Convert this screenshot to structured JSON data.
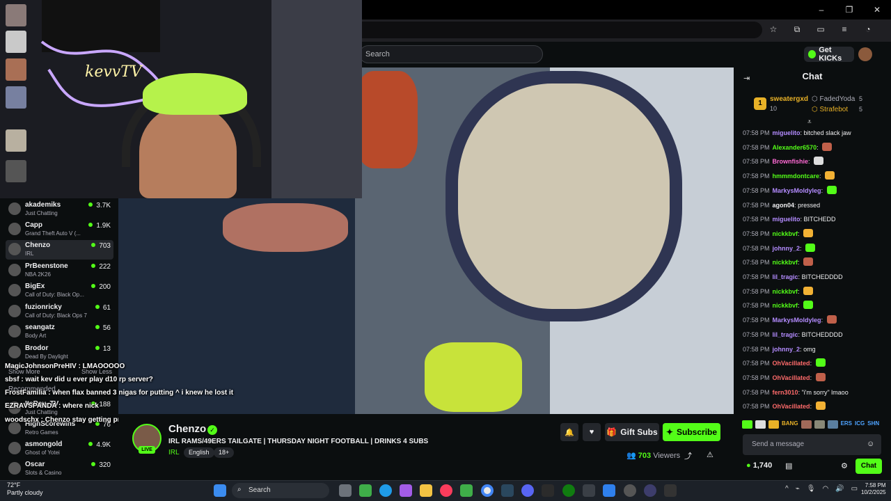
{
  "browser": {
    "window_controls": [
      "–",
      "❐",
      "✕"
    ],
    "toolbar_icons": [
      "star-icon",
      "extensions-icon",
      "cast-icon",
      "menu-list-icon",
      "profile-icon",
      "kebab-menu-icon"
    ]
  },
  "header": {
    "search_placeholder": "Search",
    "get_kicks": "Get KICKs"
  },
  "webcam": {
    "neon_sign": "kevvTV"
  },
  "sidebar": {
    "channels": [
      {
        "name": "akademiks",
        "game": "Just Chatting",
        "viewers": "3.7K"
      },
      {
        "name": "Capp",
        "game": "Grand Theft Auto V (...",
        "viewers": "1.9K"
      },
      {
        "name": "Chenzo",
        "game": "IRL",
        "viewers": "703",
        "active": true
      },
      {
        "name": "PrBeenstone",
        "game": "NBA 2K26",
        "viewers": "222"
      },
      {
        "name": "BigEx",
        "game": "Call of Duty: Black Op...",
        "viewers": "200"
      },
      {
        "name": "fuzionricky",
        "game": "Call of Duty: Black Ops 7",
        "viewers": "61"
      },
      {
        "name": "seangatz",
        "game": "Body Art",
        "viewers": "56"
      },
      {
        "name": "Brodor",
        "game": "Dead By Daylight",
        "viewers": "13"
      }
    ],
    "show_more": "Show More",
    "show_less": "Show Less",
    "recommended_title": "Recommended",
    "recommended": [
      {
        "name": "ItsRay_TV",
        "game": "Just Chatting",
        "viewers": "188"
      },
      {
        "name": "HighScorewins",
        "game": "Retro Games",
        "viewers": "76"
      },
      {
        "name": "asmongold",
        "game": "Ghost of Yotei",
        "viewers": "4.9K"
      },
      {
        "name": "Oscar",
        "game": "Slots & Casino",
        "viewers": "320"
      }
    ]
  },
  "overlay_chat": [
    "MagicJohnsonPreHIV : LMAOOOOO",
    "sbsf : wait kev did u ever play d10 rp server?",
    "FrostFamilia : when flax banned 3 nigas for putting ^ i knew he lost it",
    "EZRAVSPANDA : where nick",
    "woodschx : Chenzo stay getting pressed"
  ],
  "stream": {
    "name": "Chenzo",
    "live": "LIVE",
    "title": "IRL RAMS/49ERS TAILGATE | THURSDAY NIGHT FOOTBALL | DRINKS 4 SUBS",
    "category": "IRL",
    "tags": [
      "English",
      "18+"
    ],
    "gift_subs": "Gift Subs",
    "subscribe": "Subscribe",
    "viewer_count": "703",
    "viewers_label": "Viewers"
  },
  "chat": {
    "title": "Chat",
    "pinned": {
      "rank": "1",
      "top_user": "sweatergxd",
      "top_count": "10",
      "others": [
        {
          "name": "FadedYoda",
          "count": "5"
        },
        {
          "name": "Strafebot",
          "count": "5"
        }
      ]
    },
    "messages": [
      {
        "time": "07:58 PM",
        "user": "miguelito",
        "color": "#b48cff",
        "text": "bitched slack jaw"
      },
      {
        "time": "07:58 PM",
        "user": "Alexander6570",
        "color": "#53fc18",
        "text": ""
      },
      {
        "time": "07:58 PM",
        "user": "Brownfishie",
        "color": "#ff6ad5",
        "text": ""
      },
      {
        "time": "07:58 PM",
        "user": "hmmmdontcare",
        "color": "#53fc18",
        "text": ""
      },
      {
        "time": "07:58 PM",
        "user": "MarkysMoldyleg",
        "color": "#b48cff",
        "text": ""
      },
      {
        "time": "07:58 PM",
        "user": "agon04",
        "color": "#efeff1",
        "text": "pressed"
      },
      {
        "time": "07:58 PM",
        "user": "miguelito",
        "color": "#b48cff",
        "text": "BITCHEDD"
      },
      {
        "time": "07:58 PM",
        "user": "nickkbvf",
        "color": "#53fc18",
        "text": ""
      },
      {
        "time": "07:58 PM",
        "user": "johnny_2",
        "color": "#b48cff",
        "text": ""
      },
      {
        "time": "07:58 PM",
        "user": "nickkbvf",
        "color": "#53fc18",
        "text": ""
      },
      {
        "time": "07:58 PM",
        "user": "lil_tragic",
        "color": "#b48cff",
        "text": "BITCHEDDDD"
      },
      {
        "time": "07:58 PM",
        "user": "nickkbvf",
        "color": "#53fc18",
        "text": ""
      },
      {
        "time": "07:58 PM",
        "user": "nickkbvf",
        "color": "#53fc18",
        "text": ""
      },
      {
        "time": "07:58 PM",
        "user": "MarkysMoldyleg",
        "color": "#b48cff",
        "text": ""
      },
      {
        "time": "07:58 PM",
        "user": "lil_tragic",
        "color": "#b48cff",
        "text": "BITCHEDDDD"
      },
      {
        "time": "07:58 PM",
        "user": "johnny_2",
        "color": "#b48cff",
        "text": "omg"
      },
      {
        "time": "07:58 PM",
        "user": "OhVacillated",
        "color": "#ff6b6b",
        "text": ""
      },
      {
        "time": "07:58 PM",
        "user": "OhVacillated",
        "color": "#ff6b6b",
        "text": ""
      },
      {
        "time": "07:58 PM",
        "user": "fern3010",
        "color": "#ff6b6b",
        "text": "\"i'm sorry\" lmaoo"
      },
      {
        "time": "07:58 PM",
        "user": "OhVacillated",
        "color": "#ff6b6b",
        "text": ""
      }
    ],
    "emote_strip": [
      "BANG",
      "ERS",
      "ICG",
      "SHN"
    ],
    "send_placeholder": "Send a message",
    "kicks_balance": "1,740",
    "chat_button": "Chat"
  },
  "taskbar": {
    "temp": "72°F",
    "weather": "Partly cloudy",
    "search": "Search",
    "time": "7:58 PM",
    "date": "10/2/2025"
  }
}
